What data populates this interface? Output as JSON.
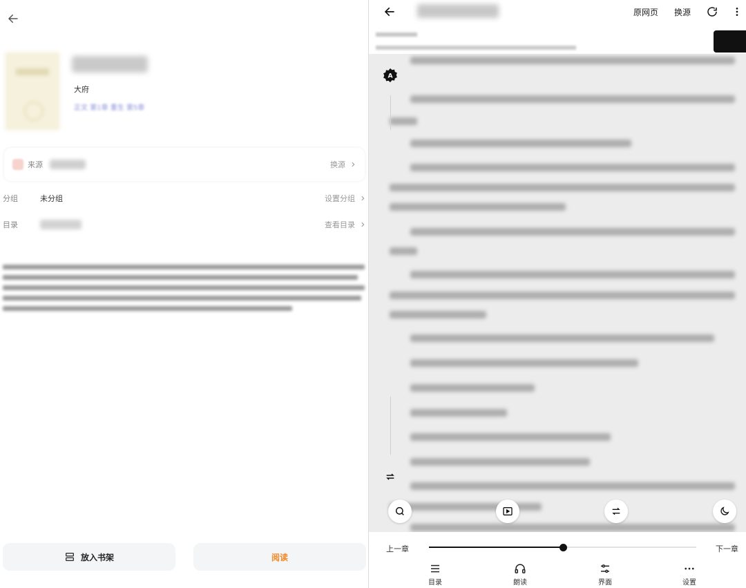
{
  "left": {
    "author": "大府",
    "latest_chapter": "正文 第1章 重生 第5章",
    "source_label": "来源",
    "change_source": "换源",
    "group_key": "分组",
    "group_value": "未分组",
    "set_group": "设置分组",
    "toc_key": "目录",
    "view_toc": "查看目录",
    "shelf_button": "放入书架",
    "read_button": "阅读"
  },
  "right": {
    "actions": {
      "original_page": "原网页",
      "change_source": "换源"
    },
    "bottom": {
      "prev_chapter": "上一章",
      "next_chapter": "下一章",
      "progress": 0.5,
      "tabs": [
        "目录",
        "朗读",
        "界面",
        "设置"
      ]
    }
  },
  "colors": {
    "accent_orange": "#f08a29",
    "link_blue": "#8a8fd6",
    "reader_bg": "#ececec"
  }
}
